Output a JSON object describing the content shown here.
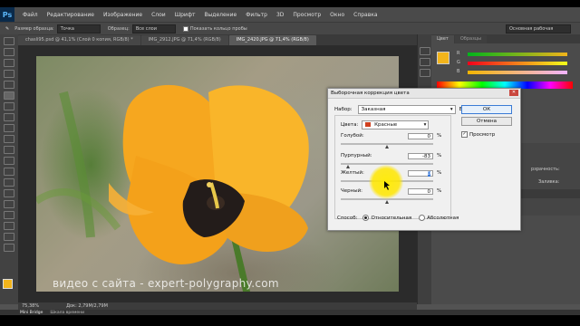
{
  "app": {
    "logo": "Ps"
  },
  "menu": [
    "Файл",
    "Редактирование",
    "Изображение",
    "Слои",
    "Шрифт",
    "Выделение",
    "Фильтр",
    "3D",
    "Просмотр",
    "Окно",
    "Справка"
  ],
  "options_bar": {
    "sample_size_label": "Размер образца:",
    "sample_size_value": "Точка",
    "sample_label": "Образец:",
    "sample_value": "Все слои",
    "show_ring": "Показать кольцо пробы",
    "workspace": "Основная рабочая среда"
  },
  "tabs": [
    "chasli95.psd @ 41,1% (Слой 0 копия, RGB/8) *",
    "IMG_2912.JPG @ 71,4% (RGB/8)",
    "IMG_2420.JPG @ 71,4% (RGB/8)"
  ],
  "status": {
    "zoom": "75,38%",
    "doc": "Док: 2,79M/2,79M"
  },
  "mini_bridge": {
    "label": "Mini Bridge",
    "timeline": "Шкала времени"
  },
  "watermark": "видео с сайта - expert-polygraphy.com",
  "panels": {
    "tabs": [
      "Цвет",
      "Образцы"
    ],
    "labels": [
      "R",
      "G",
      "B"
    ],
    "blend_label": "рзрачность:",
    "fill_label": "Заливка:"
  },
  "colors": {
    "photoshop_blue": "#5ab4f5",
    "fg_swatch": "#f2b41b",
    "petal": "#f6a71f",
    "stem": "#4a7a2a",
    "cursor": "#ffe600",
    "red_swatch": "#d0401e"
  },
  "dialog": {
    "title": "Выборочная коррекция цвета",
    "close": "✕",
    "preset_label": "Набор:",
    "preset_value": "Заказная",
    "preset_icon": "E,",
    "colors_label": "Цвета:",
    "colors_value": "Красные",
    "sliders": [
      {
        "label": "Голубой:",
        "value": "0",
        "unit": "%",
        "level": 0
      },
      {
        "label": "Пурпурный:",
        "value": "-83",
        "unit": "%",
        "level": -83
      },
      {
        "label": "Желтый:",
        "value": "0",
        "unit": "%",
        "level": 0
      },
      {
        "label": "Черный:",
        "value": "0",
        "unit": "%",
        "level": 0
      }
    ],
    "method_label": "Способ:",
    "relative": "Относительная",
    "absolute": "Абсолютная",
    "ok": "ОК",
    "cancel": "Отмена",
    "preview": "Просмотр"
  }
}
